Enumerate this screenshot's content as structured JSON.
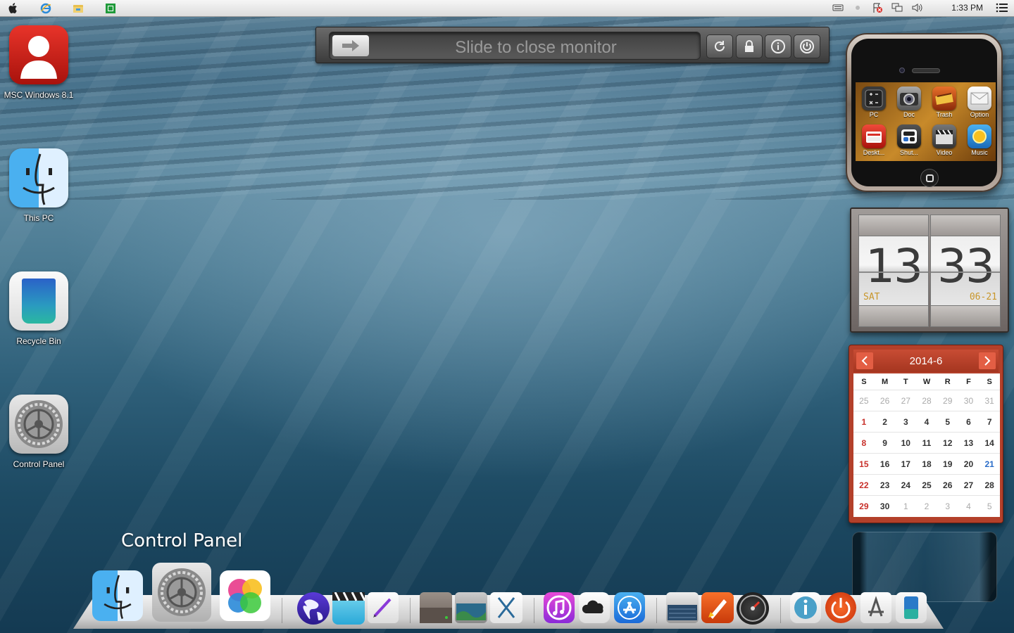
{
  "menubar": {
    "left_icons": [
      "apple-icon",
      "internet-explorer-icon",
      "file-explorer-icon",
      "store-icon"
    ],
    "right_icons": [
      "keyboard-icon",
      "dot-icon",
      "flag-icon",
      "network-icon",
      "volume-icon"
    ],
    "clock": "1:33 PM",
    "menu_icon": "list-icon"
  },
  "desktop_icons": [
    {
      "label": "MSC Windows 8.1",
      "icon": "user-icon"
    },
    {
      "label": "This PC",
      "icon": "finder-icon"
    },
    {
      "label": "Recycle Bin",
      "icon": "recycle-bin-icon"
    },
    {
      "label": "Control Panel",
      "icon": "settings-gear-icon"
    }
  ],
  "slider": {
    "text": "Slide to close monitor",
    "buttons": [
      "refresh-icon",
      "lock-icon",
      "info-icon",
      "power-icon"
    ]
  },
  "phone_widget": {
    "apps": [
      {
        "label": "PC",
        "color": "#3a3a3a"
      },
      {
        "label": "Doc",
        "color": "#5a5a5a"
      },
      {
        "label": "Trash",
        "color": "#b8461a"
      },
      {
        "label": "Option",
        "color": "#e8e8e8"
      },
      {
        "label": "Deskt...",
        "color": "#c82a22"
      },
      {
        "label": "Shut...",
        "color": "#2a2a2a"
      },
      {
        "label": "Video",
        "color": "#444444"
      },
      {
        "label": "Music",
        "color": "#2a8ad8"
      }
    ]
  },
  "flip_clock": {
    "hours": "13",
    "minutes": "33",
    "day": "SAT",
    "date": "06-21"
  },
  "calendar": {
    "title": "2014-6",
    "weekdays": [
      "S",
      "M",
      "T",
      "W",
      "R",
      "F",
      "S"
    ],
    "weeks": [
      [
        "25",
        "26",
        "27",
        "28",
        "29",
        "30",
        "31"
      ],
      [
        "1",
        "2",
        "3",
        "4",
        "5",
        "6",
        "7"
      ],
      [
        "8",
        "9",
        "10",
        "11",
        "12",
        "13",
        "14"
      ],
      [
        "15",
        "16",
        "17",
        "18",
        "19",
        "20",
        "21"
      ],
      [
        "22",
        "23",
        "24",
        "25",
        "26",
        "27",
        "28"
      ],
      [
        "29",
        "30",
        "1",
        "2",
        "3",
        "4",
        "5"
      ]
    ],
    "today": "21"
  },
  "dock": {
    "hover_label": "Control Panel",
    "items": [
      "finder-icon",
      "settings-gear-icon",
      "game-center-icon",
      "globe-icon",
      "clapperboard-icon",
      "pen-icon",
      "hard-drive-icon",
      "photo-scanner-icon",
      "x-icon",
      "itunes-icon",
      "cloud-icon",
      "app-store-icon",
      "scanner-icon",
      "rocket-icon",
      "dashboard-icon",
      "info-icon",
      "power-icon",
      "app-icon",
      "recycle-bin-icon"
    ]
  },
  "colors": {
    "calendar_red": "#b3402a",
    "sunday_red": "#c8302a",
    "today_blue": "#2a6cc8",
    "flip_accent": "#c8962a"
  }
}
